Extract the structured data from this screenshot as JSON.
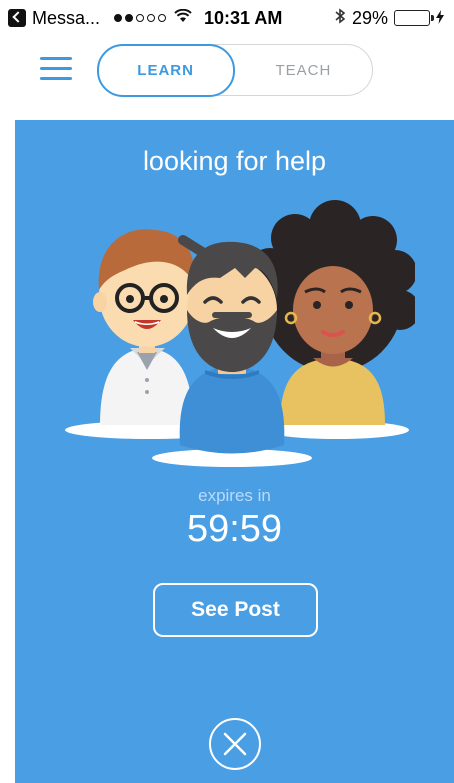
{
  "status_bar": {
    "back_app": "Messa...",
    "time": "10:31 AM",
    "battery": "29%",
    "signal_bars_filled": 2,
    "signal_bars_total": 5
  },
  "nav": {
    "tabs": [
      {
        "label": "LEARN",
        "active": true
      },
      {
        "label": "TEACH",
        "active": false
      }
    ]
  },
  "panel": {
    "title": "looking for help",
    "expires_label": "expires in",
    "timer": "59:59",
    "button_label": "See Post"
  },
  "colors": {
    "accent": "#3d9ae0",
    "panel": "#4a9fe4",
    "expires_text": "#b9dafb"
  },
  "icons": [
    "menu-icon",
    "close-icon",
    "wifi-icon",
    "bluetooth-icon",
    "battery-icon",
    "charging-icon"
  ]
}
